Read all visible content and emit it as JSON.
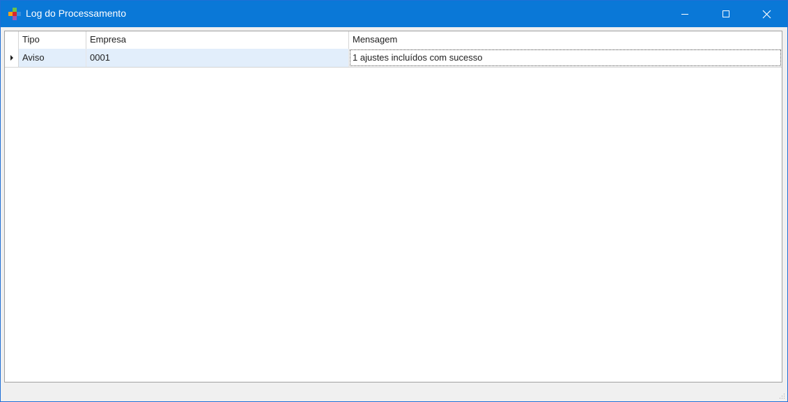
{
  "window": {
    "title": "Log do Processamento",
    "accent_color": "#0a78d7"
  },
  "title_controls": {
    "minimize_icon": "minimize-icon",
    "maximize_icon": "maximize-icon",
    "close_icon": "close-icon"
  },
  "grid": {
    "columns": [
      "Tipo",
      "Empresa",
      "Mensagem"
    ],
    "rows": [
      {
        "tipo": "Aviso",
        "empresa": "0001",
        "mensagem": "1 ajustes incluídos com sucesso"
      }
    ],
    "current_row_icon": "row-pointer-icon"
  }
}
